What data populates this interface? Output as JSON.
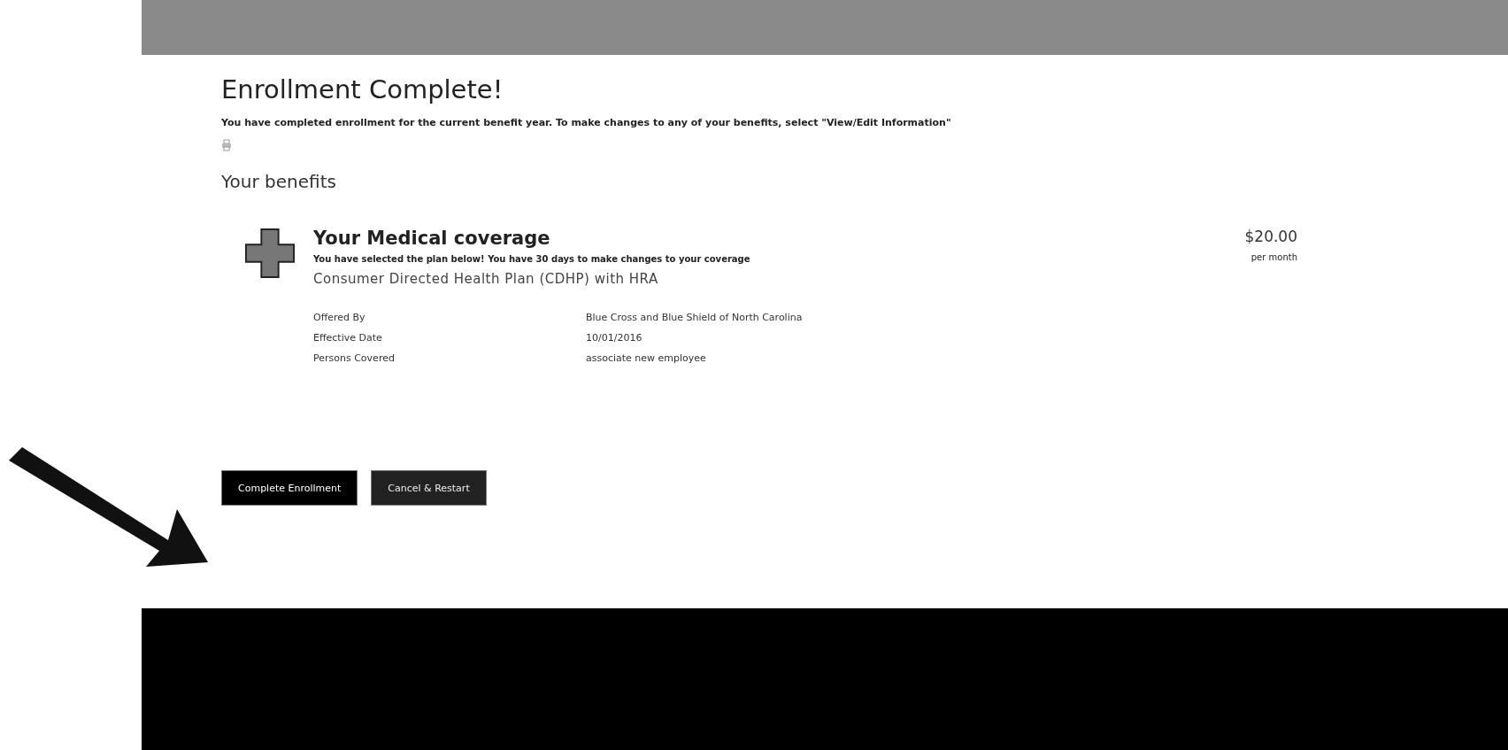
{
  "page": {
    "title": "Enrollment Complete!",
    "message": "You have completed enrollment for the current benefit year. To make changes to any of your benefits, select \"View/Edit Information\""
  },
  "benefits": {
    "heading": "Your benefits",
    "items": [
      {
        "title": "Your Medical coverage",
        "note": "You have selected the plan below! You have 30 days to make changes to your coverage",
        "plan": "Consumer Directed Health Plan (CDHP) with HRA",
        "price": "$20.00",
        "period": "per month",
        "details": [
          {
            "label": "Offered By",
            "value": "Blue Cross and Blue Shield of North Carolina"
          },
          {
            "label": "Effective Date",
            "value": "10/01/2016"
          },
          {
            "label": "Persons Covered",
            "value": "associate new employee"
          }
        ]
      }
    ]
  },
  "buttons": [
    {
      "label": "Complete Enrollment"
    },
    {
      "label": "Cancel & Restart"
    }
  ]
}
